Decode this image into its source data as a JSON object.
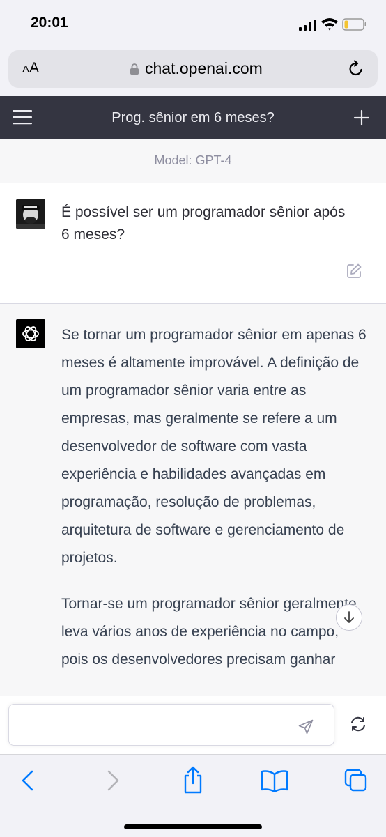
{
  "status_bar": {
    "time": "20:01"
  },
  "browser": {
    "text_size_small": "A",
    "text_size_large": "A",
    "url": "chat.openai.com"
  },
  "chat": {
    "title": "Prog. sênior em 6 meses?",
    "model_label": "Model: GPT-4",
    "user_message": "É possível ser um programador sênior após 6 meses?",
    "assistant_paragraphs": [
      "Se tornar um programador sênior em apenas 6 meses é altamente improvável. A definição de um programador sênior varia entre as empresas, mas geralmente se refere a um desenvolvedor de software com vasta experiência e habilidades avançadas em programação, resolução de problemas, arquitetura de software e gerenciamento de projetos.",
      "Tornar-se um programador sênior geralmente leva vários anos de experiência no campo, pois os desenvolvedores precisam ganhar"
    ],
    "composer_placeholder": ""
  },
  "icons": {
    "lock": "lock-icon",
    "reload": "reload-icon",
    "menu": "menu-icon",
    "new_chat": "plus-icon",
    "edit": "edit-icon",
    "send": "send-icon",
    "regenerate": "regenerate-icon",
    "back": "chevron-left-icon",
    "forward": "chevron-right-icon",
    "share": "share-icon",
    "bookmarks": "book-icon",
    "tabs": "tabs-icon",
    "scroll_down": "arrow-down-icon"
  },
  "colors": {
    "header_bg": "#343541",
    "assistant_bg": "#f7f7f8",
    "safari_blue": "#007aff"
  }
}
